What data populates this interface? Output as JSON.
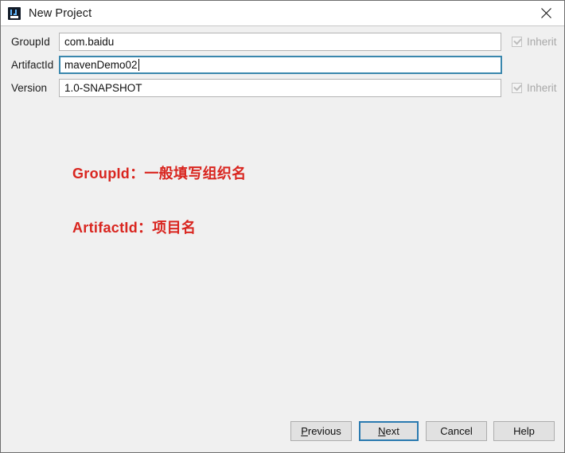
{
  "window": {
    "title": "New Project",
    "icon": "intellij-idea-icon",
    "close_icon": "close-icon"
  },
  "form": {
    "fields": [
      {
        "label": "GroupId",
        "value": "com.baidu",
        "focused": false,
        "inherit": {
          "label": "Inherit",
          "checked": true,
          "enabled": false
        }
      },
      {
        "label": "ArtifactId",
        "value": "mavenDemo02",
        "focused": true,
        "inherit": null
      },
      {
        "label": "Version",
        "value": "1.0-SNAPSHOT",
        "focused": false,
        "inherit": {
          "label": "Inherit",
          "checked": true,
          "enabled": false
        }
      }
    ]
  },
  "annotations": [
    {
      "text": "GroupId：一般填写组织名",
      "color": "#d9251f"
    },
    {
      "text": "ArtifactId：项目名",
      "color": "#d9251f"
    }
  ],
  "buttons": {
    "previous": {
      "mnemonic": "P",
      "rest": "revious"
    },
    "next": {
      "mnemonic": "N",
      "rest": "ext"
    },
    "cancel": {
      "label": "Cancel"
    },
    "help": {
      "label": "Help"
    }
  },
  "colors": {
    "dialog_background": "#f0f0f0",
    "titlebar_background": "#ffffff",
    "accent_focus": "#2a7ab0",
    "annotation_red": "#d9251f",
    "icon_navy": "#121b28",
    "icon_blue": "#63b8ff"
  }
}
